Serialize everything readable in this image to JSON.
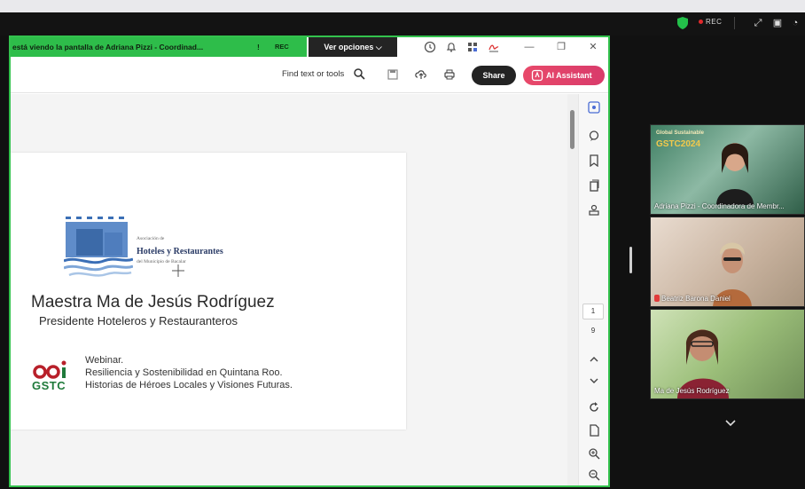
{
  "zoom": {
    "rec_label": "REC",
    "icons": [
      "shield-icon",
      "expand-icon",
      "gallery-icon",
      "more-icon"
    ]
  },
  "share": {
    "banner_text": "está viendo la pantalla de  Adriana Pizzi - Coordinad...",
    "banner_pin": "!",
    "banner_rec": "REC",
    "options_label": "Ver opciones",
    "options_chevron": "⌵"
  },
  "acrobat": {
    "find_text": "Find text or tools",
    "share_label": "Share",
    "ai_label": "AI Assistant",
    "page_current": "1",
    "page_total": "9"
  },
  "slide": {
    "assoc_small": "Asociación de",
    "assoc_name": "Hoteles y Restaurantes",
    "assoc_sub": "del Municipio de Bacalar",
    "speaker_name": "Maestra Ma de Jesús Rodríguez",
    "speaker_role": "Presidente Hoteleros y Restauranteros",
    "gstc": "GSTC",
    "webinar_line1": "Webinar.",
    "webinar_line2": "Resiliencia y Sostenibilidad en Quintana Roo.",
    "webinar_line3": "Historias de Héroes Locales y Visiones Futuras."
  },
  "participants": [
    {
      "name": "Adriana Pizzi - Coordinadora de Membr...",
      "bg_text_1": "Global Sustainable",
      "bg_text_2": "GSTC2024",
      "muted": false
    },
    {
      "name": "Beatriz Barona Daniel",
      "muted": true
    },
    {
      "name": "Ma de Jesús Rodríguez",
      "muted": false
    }
  ],
  "colors": {
    "share_border": "#33c24d",
    "ai_button": "#e8496a",
    "gstc_green": "#1f7a3b",
    "assoc_blue": "#2a3b66"
  }
}
